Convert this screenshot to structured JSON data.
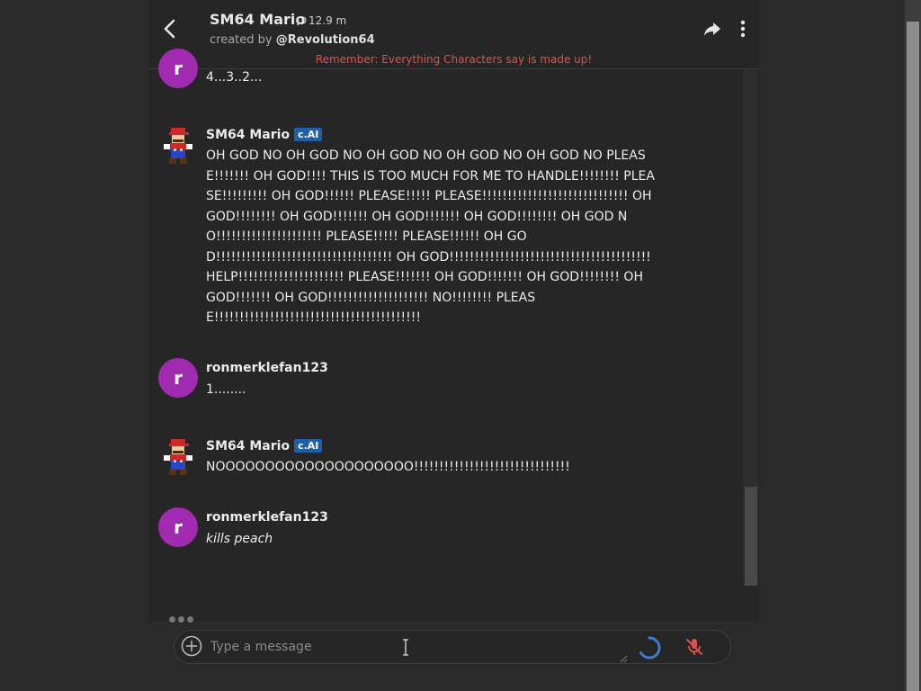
{
  "header": {
    "character_name": "SM64 Mario",
    "chat_count": "12.9 m",
    "created_prefix": "created by",
    "creator": "@Revolution64",
    "warning": "Remember: Everything Characters say is made up!"
  },
  "messages": [
    {
      "author": "",
      "avatar": "r",
      "text": "4...3..2..."
    },
    {
      "author": "SM64 Mario",
      "badge": "c.AI",
      "text": "OH GOD NO OH GOD NO OH GOD NO OH GOD NO OH GOD NO PLEASE!!!!!!! OH GOD!!!! THIS IS TOO MUCH FOR ME TO HANDLE!!!!!!!! PLEASE!!!!!!!!! OH GOD!!!!!! PLEASE!!!!! PLEASE!!!!!!!!!!!!!!!!!!!!!!!!!!!!! OH GOD!!!!!!!! OH GOD!!!!!!! OH GOD!!!!!!! OH GOD!!!!!!!! OH GOD NO!!!!!!!!!!!!!!!!!!!!! PLEASE!!!!! PLEASE!!!!!! OH GOD!!!!!!!!!!!!!!!!!!!!!!!!!!!!!!!!!!! OH GOD!!!!!!!!!!!!!!!!!!!!!!!!!!!!!!!!!!!!!!!! HELP!!!!!!!!!!!!!!!!!!!!! PLEASE!!!!!!! OH GOD!!!!!!! OH GOD!!!!!!!! OH GOD!!!!!!! OH GOD!!!!!!!!!!!!!!!!!!!! NO!!!!!!!! PLEASE!!!!!!!!!!!!!!!!!!!!!!!!!!!!!!!!!!!!!!!!!"
    },
    {
      "author": "ronmerklefan123",
      "avatar": "r",
      "text": "1........"
    },
    {
      "author": "SM64 Mario",
      "badge": "c.AI",
      "text": "NOOOOOOOOOOOOOOOOOOOO!!!!!!!!!!!!!!!!!!!!!!!!!!!!!!!"
    },
    {
      "author": "ronmerklefan123",
      "avatar": "r",
      "text": "kills peach"
    }
  ],
  "composer": {
    "placeholder": "Type a message"
  },
  "icons": {
    "back": "chevron-left-icon",
    "share": "share-icon",
    "more": "more-vertical-icon",
    "add": "plus-circle-icon",
    "mic": "mic-muted-icon"
  },
  "colors": {
    "background": "#262626",
    "user_avatar": "#a12bb0",
    "badge": "#1f5ea8",
    "warning": "#d9534f",
    "spinner": "#3a7bd5",
    "mic_muted": "#d9534f"
  }
}
